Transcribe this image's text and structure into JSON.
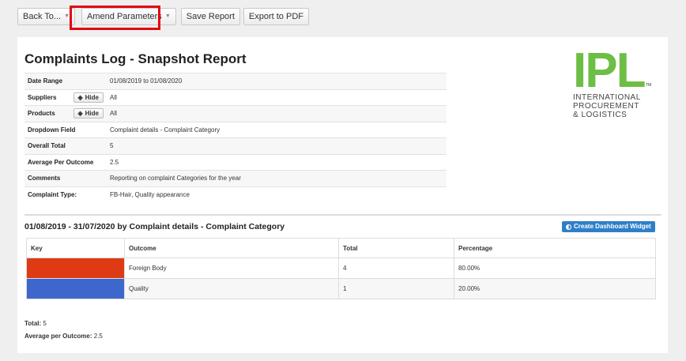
{
  "toolbar": {
    "back_label": "Back To...",
    "amend_label": "Amend Parameters",
    "save_label": "Save Report",
    "export_label": "Export to PDF"
  },
  "report": {
    "title": "Complaints Log - Snapshot Report",
    "info": [
      {
        "label": "Date Range",
        "value": "01/08/2019 to 01/08/2020"
      },
      {
        "label": "Suppliers",
        "value": "All",
        "hide": "Hide"
      },
      {
        "label": "Products",
        "value": "All",
        "hide": "Hide"
      },
      {
        "label": "Dropdown Field",
        "value": "Complaint details - Complaint Category"
      },
      {
        "label": "Overall Total",
        "value": "5"
      },
      {
        "label": "Average Per Outcome",
        "value": "2.5"
      },
      {
        "label": "Comments",
        "value": "Reporting on complaint Categories for the year"
      },
      {
        "label": "Complaint Type:",
        "value": "FB-Hair, Quality appearance"
      }
    ]
  },
  "logo": {
    "mark": "IPL",
    "tm": "TM",
    "line1": "INTERNATIONAL",
    "line2": "PROCUREMENT",
    "line3": "& LOGISTICS",
    "color": "#6dbe45"
  },
  "section": {
    "title": "01/08/2019 - 31/07/2020 by Complaint details - Complaint Category",
    "widget_label": "Create Dashboard Widget"
  },
  "table": {
    "headers": [
      "Key",
      "Outcome",
      "Total",
      "Percentage"
    ],
    "rows": [
      {
        "color": "#de3a14",
        "outcome": "Foreign Body",
        "total": "4",
        "percentage": "80.00%"
      },
      {
        "color": "#3d67cc",
        "outcome": "Quality",
        "total": "1",
        "percentage": "20.00%"
      }
    ]
  },
  "footer": {
    "total_label": "Total:",
    "total_value": "5",
    "avg_label": "Average per Outcome:",
    "avg_value": "2.5"
  }
}
